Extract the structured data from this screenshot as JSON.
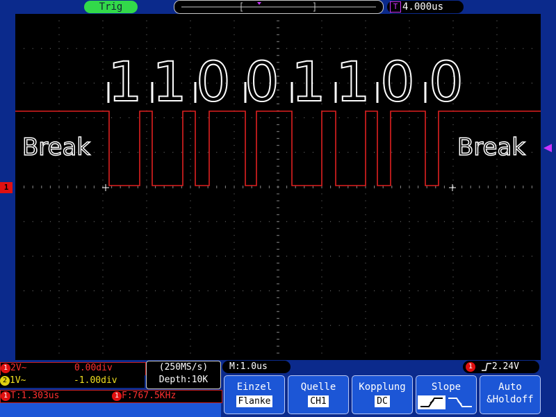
{
  "header": {
    "trig_label": "Trig",
    "time_position_icon": "T",
    "time_position": "4.000us"
  },
  "screen": {
    "bits": [
      "1",
      "1",
      "0",
      "0",
      "1",
      "1",
      "0",
      "0"
    ],
    "break_left": "Break",
    "break_right": "Break",
    "channel_marker": "1",
    "colors": {
      "trace": "#e02020",
      "grid": "#808080",
      "text": "#ffffff",
      "marker": "#cc33ff",
      "accent": "#32d94a",
      "panel": "#1c56d6"
    }
  },
  "status": {
    "ch1": {
      "num": "1",
      "coupling": "2V~",
      "offset": "0.00div"
    },
    "ch2": {
      "num": "2",
      "coupling": "1V~",
      "offset": "-1.00div"
    },
    "sample_rate": "(250MS/s)",
    "depth": "Depth:10K",
    "time_base": "M:1.0us",
    "trigger_level": "2.24V",
    "period": "T:1.303us",
    "frequency": "F:767.5KHz"
  },
  "menu": [
    {
      "title": "Einzel",
      "value": "Flanke"
    },
    {
      "title": "Quelle",
      "value": "CH1"
    },
    {
      "title": "Kopplung",
      "value": "DC"
    },
    {
      "title": "Slope",
      "value": ""
    },
    {
      "title": "Auto",
      "value": "&Holdoff"
    }
  ]
}
